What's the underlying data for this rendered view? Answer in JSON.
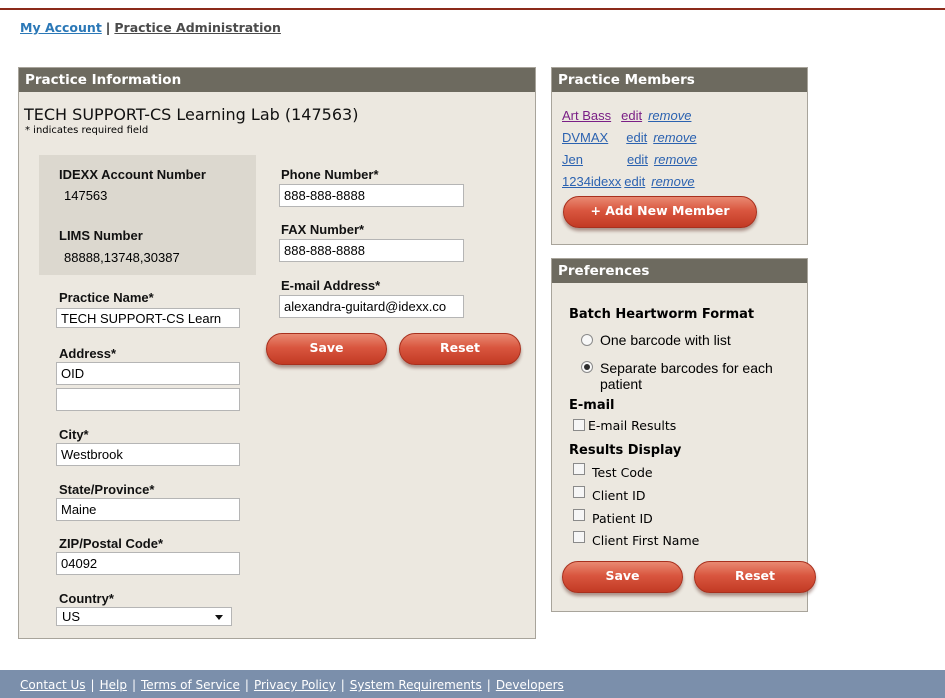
{
  "nav": {
    "my_account": "My Account",
    "separator": "|",
    "practice_admin": "Practice Administration"
  },
  "practice": {
    "header": "Practice Information",
    "title": "TECH SUPPORT-CS Learning Lab (147563)",
    "required_note": "* indicates required field",
    "account_label": "IDEXX Account Number",
    "account_value": "147563",
    "lims_label": "LIMS Number",
    "lims_value": "88888,13748,30387",
    "name_label": "Practice Name*",
    "name_value": "TECH SUPPORT-CS Learn",
    "address_label": "Address*",
    "address_value": "OID",
    "address2_value": "",
    "city_label": "City*",
    "city_value": "Westbrook",
    "state_label": "State/Province*",
    "state_value": "Maine",
    "zip_label": "ZIP/Postal Code*",
    "zip_value": "04092",
    "country_label": "Country*",
    "country_value": "US",
    "phone_label": "Phone Number*",
    "phone_value": "888-888-8888",
    "fax_label": "FAX Number*",
    "fax_value": "888-888-8888",
    "email_label": "E-mail Address*",
    "email_value": "alexandra-guitard@idexx.co",
    "save_label": "Save",
    "reset_label": "Reset"
  },
  "members": {
    "header": "Practice Members",
    "rows": [
      {
        "name": "Art Bass",
        "edit": "edit",
        "remove": "remove"
      },
      {
        "name": "DVMAX",
        "edit": "edit",
        "remove": "remove"
      },
      {
        "name": "Jen",
        "edit": "edit",
        "remove": "remove"
      },
      {
        "name": "1234idexx",
        "edit": "edit",
        "remove": "remove"
      }
    ],
    "add_label": "+ Add New Member"
  },
  "preferences": {
    "header": "Preferences",
    "batch_title": "Batch Heartworm Format",
    "opt1": "One barcode with list",
    "opt2": "Separate barcodes for each patient",
    "selected_option": "Separate barcodes for each patient",
    "email_title": "E-mail",
    "email_results": "E-mail Results",
    "results_title": "Results Display",
    "test_code": "Test Code",
    "client_id": "Client ID",
    "patient_id": "Patient ID",
    "client_first_name": "Client First Name",
    "save_label": "Save",
    "reset_label": "Reset"
  },
  "footer": {
    "links": [
      "Contact Us",
      "Help",
      "Terms of Service",
      "Privacy Policy",
      "System Requirements",
      "Developers"
    ],
    "separator": "|"
  }
}
